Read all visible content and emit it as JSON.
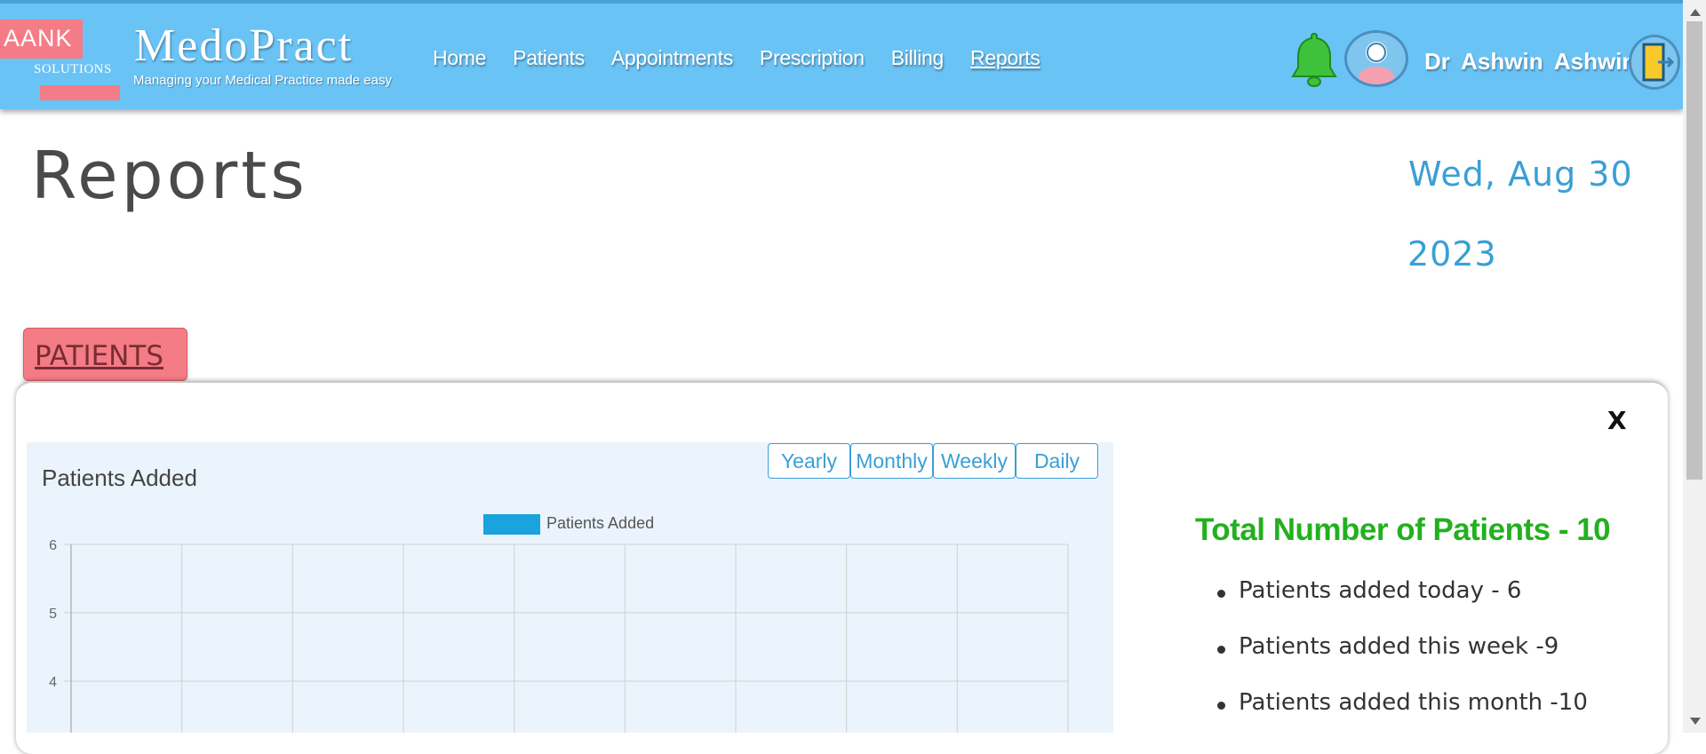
{
  "header": {
    "logo_text": "AANK",
    "logo_subtext": "SOLUTIONS",
    "brand": "MedoPract",
    "tagline": "Managing your Medical Practice made easy",
    "nav": [
      {
        "label": "Home"
      },
      {
        "label": "Patients"
      },
      {
        "label": "Appointments"
      },
      {
        "label": "Prescription"
      },
      {
        "label": "Billing"
      },
      {
        "label": "Reports"
      }
    ],
    "active_nav": "Reports",
    "user_name": "Dr Ashwin Ashwin",
    "icons": {
      "notification": "bell-icon",
      "profile": "user-avatar-icon",
      "logout": "logout-door-icon"
    }
  },
  "page": {
    "title": "Reports",
    "date_line1": "Wed, Aug 30",
    "date_line2": "2023"
  },
  "section": {
    "tab_label": "PATIENTS",
    "close_label": "X",
    "range_buttons": [
      "Yearly",
      "Monthly",
      "Weekly",
      "Daily"
    ]
  },
  "chart_data": {
    "type": "bar",
    "title": "Patients Added",
    "series": [
      {
        "name": "Patients Added",
        "values": []
      }
    ],
    "y_ticks": [
      6,
      5,
      4
    ],
    "grid": true,
    "legend": "top-center",
    "color": "#1aa3dc"
  },
  "stats": {
    "total": "Total Number of Patients - 10",
    "items": [
      "Patients added today - 6",
      "Patients added this week -9",
      "Patients added this month -10"
    ]
  },
  "colors": {
    "header_bg": "#6ac3f5",
    "accent": "#3a9fd5",
    "tab_bg": "#f47c86",
    "total_green": "#22b01f"
  }
}
